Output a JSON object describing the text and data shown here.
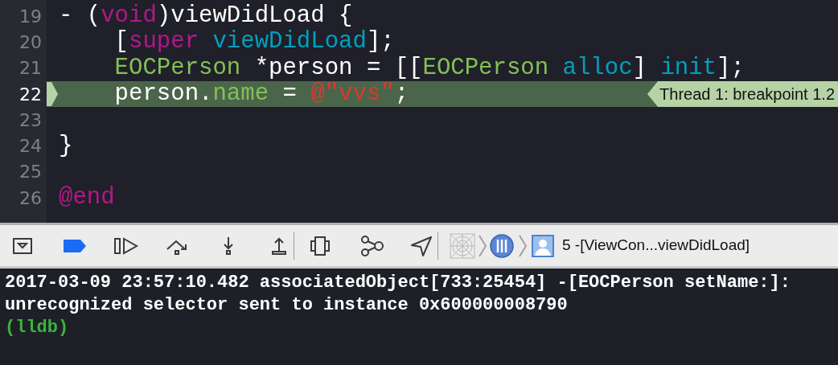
{
  "editor": {
    "lines": [
      {
        "number": "19",
        "current": false,
        "tokens": [
          {
            "kind": "plain",
            "text": "- ("
          },
          {
            "kind": "keyword",
            "text": "void"
          },
          {
            "kind": "plain",
            "text": ")viewDidLoad {"
          }
        ]
      },
      {
        "number": "20",
        "current": false,
        "tokens": [
          {
            "kind": "plain",
            "text": "    ["
          },
          {
            "kind": "keyword",
            "text": "super"
          },
          {
            "kind": "method",
            "text": " viewDidLoad"
          },
          {
            "kind": "plain",
            "text": "];"
          }
        ]
      },
      {
        "number": "21",
        "current": false,
        "tokens": [
          {
            "kind": "class",
            "text": "    EOCPerson"
          },
          {
            "kind": "plain",
            "text": " *person = [["
          },
          {
            "kind": "class",
            "text": "EOCPerson"
          },
          {
            "kind": "method",
            "text": " alloc"
          },
          {
            "kind": "plain",
            "text": "] "
          },
          {
            "kind": "method",
            "text": "init"
          },
          {
            "kind": "plain",
            "text": "];"
          }
        ]
      },
      {
        "number": "22",
        "current": true,
        "badge": "Thread 1: breakpoint 1.2",
        "tokens": [
          {
            "kind": "plain",
            "text": "    person."
          },
          {
            "kind": "property",
            "text": "name"
          },
          {
            "kind": "plain",
            "text": " = "
          },
          {
            "kind": "string",
            "text": "@\"vvs\""
          },
          {
            "kind": "plain",
            "text": ";"
          }
        ]
      },
      {
        "number": "23",
        "current": false
      },
      {
        "number": "24",
        "current": false,
        "tokens": [
          {
            "kind": "plain",
            "text": "}"
          }
        ]
      },
      {
        "number": "25",
        "current": false
      },
      {
        "number": "26",
        "current": false,
        "tokens": [
          {
            "kind": "keyword",
            "text": "@end"
          }
        ]
      }
    ]
  },
  "debug_bar": {
    "breakpoints_active": true,
    "breadcrumb": "5 -[ViewCon...viewDidLoad]"
  },
  "console": {
    "lines": [
      {
        "kind": "output",
        "text": "2017-03-09 23:57:10.482 associatedObject[733:25454] -[EOCPerson setName:]:"
      },
      {
        "kind": "output",
        "text": "unrecognized selector sent to instance 0x600000008790"
      },
      {
        "kind": "prompt",
        "text": "(lldb)"
      }
    ]
  }
}
